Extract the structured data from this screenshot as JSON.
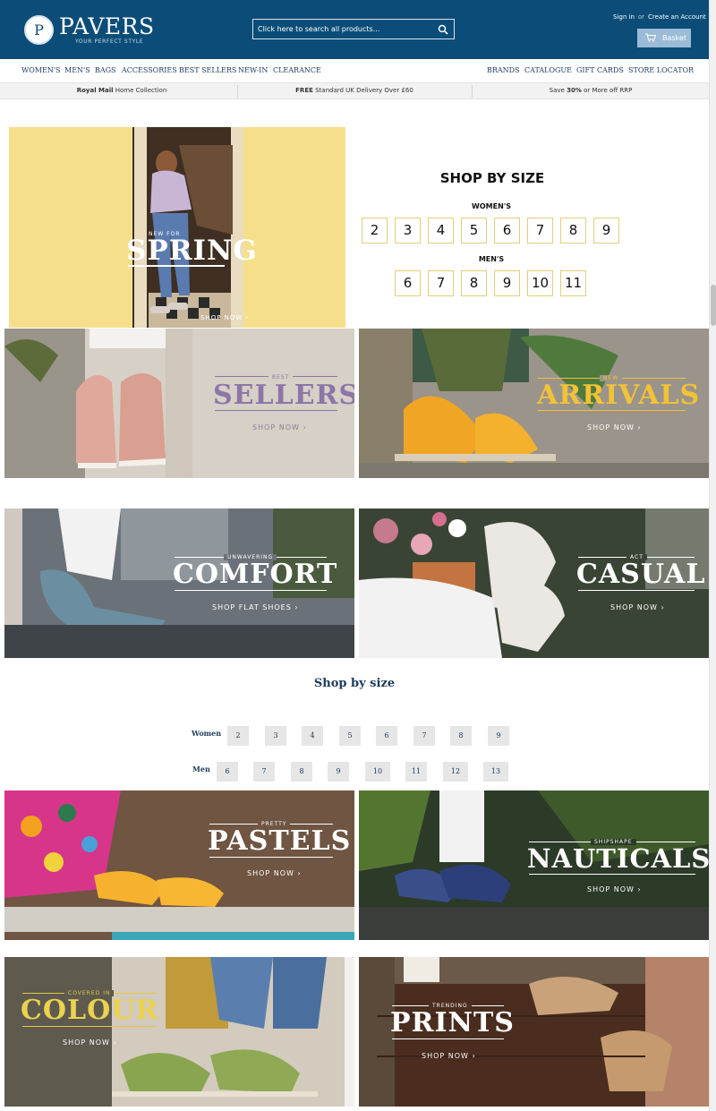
{
  "header": {
    "logo_letter": "P",
    "logo_text": "PAVERS",
    "tagline": "YOUR PERFECT STYLE",
    "search_placeholder": "Click here to search all products...",
    "sign_in": "Sign in",
    "or": "or",
    "create_account": "Create an Account",
    "basket": "Basket"
  },
  "nav": {
    "left": [
      "WOMEN'S",
      "MEN'S",
      "BAGS",
      "ACCESSORIES",
      "BEST SELLERS",
      "NEW-IN",
      "CLEARANCE"
    ],
    "right": [
      "BRANDS",
      "CATALOGUE",
      "GIFT CARDS",
      "STORE LOCATOR"
    ]
  },
  "promo": {
    "p1_bold": "Royal Mail",
    "p1_rest": " Home Collection",
    "p2_bold": "FREE",
    "p2_rest": " Standard UK Delivery Over £60",
    "p3_pre": "Save ",
    "p3_bold": "30%",
    "p3_rest": " or More off RRP"
  },
  "hero": {
    "kicker": "NEW FOR",
    "title": "SPRING",
    "cta": "SHOP NOW ›"
  },
  "shop_by_size": {
    "title": "SHOP BY SIZE",
    "women_label": "WOMEN'S",
    "women_sizes": [
      "2",
      "3",
      "4",
      "5",
      "6",
      "7",
      "8",
      "9"
    ],
    "men_label": "MEN'S",
    "men_sizes": [
      "6",
      "7",
      "8",
      "9",
      "10",
      "11"
    ]
  },
  "banners": {
    "best_sellers": {
      "kicker": "BEST",
      "title": "SELLERS",
      "cta": "SHOP NOW ›"
    },
    "new_arrivals": {
      "kicker": "NEW",
      "title": "ARRIVALS",
      "cta": "SHOP NOW ›"
    },
    "comfort": {
      "kicker": "UNWAVERING",
      "title": "COMFORT",
      "cta": "SHOP FLAT SHOES ›"
    },
    "casual": {
      "kicker": "ACT",
      "title": "CASUAL",
      "cta": "SHOP NOW ›"
    },
    "pastels": {
      "kicker": "PRETTY",
      "title": "PASTELS",
      "cta": "SHOP NOW ›"
    },
    "nauticals": {
      "kicker": "SHIPSHAPE",
      "title": "NAUTICALS",
      "cta": "SHOP NOW ›"
    },
    "colour": {
      "kicker": "COVERED IN",
      "title": "COLOUR",
      "cta": "SHOP NOW ›"
    },
    "prints": {
      "kicker": "TRENDING",
      "title": "PRINTS",
      "cta": "SHOP NOW ›"
    }
  },
  "shop_by_size_2": {
    "title": "Shop by size",
    "women_label": "Women",
    "women_sizes": [
      "2",
      "3",
      "4",
      "5",
      "6",
      "7",
      "8",
      "9"
    ],
    "men_label": "Men",
    "men_sizes": [
      "6",
      "7",
      "8",
      "9",
      "10",
      "11",
      "12",
      "13"
    ]
  },
  "colors": {
    "brand_blue": "#0b4d78",
    "basket_blue": "#9bbbd6",
    "size_border": "#e3cd7c",
    "best_sellers_title": "#8c76a8",
    "arrivals_title": "#f2c237"
  }
}
